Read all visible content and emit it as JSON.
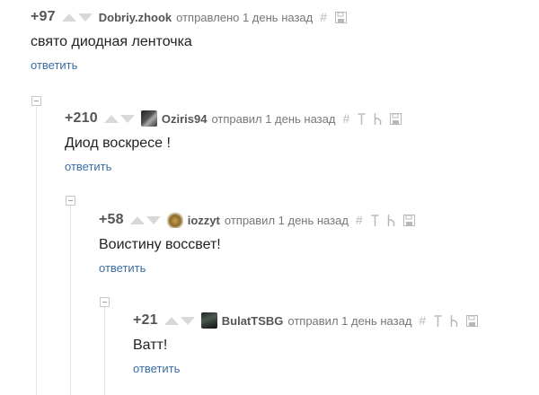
{
  "comments": [
    {
      "rating": "+97",
      "username": "Dobriy.zhook",
      "action": "отправлено 1 день назад",
      "text": "свято диодная ленточка",
      "reply": "ответить",
      "icons": [
        "hash-icon",
        "save-icon"
      ],
      "avatar_color": null
    },
    {
      "rating": "+210",
      "username": "Oziris94",
      "action": "отправил 1 день назад",
      "text": "Диод воскресе !",
      "reply": "ответить",
      "icons": [
        "hash-icon",
        "parent-arrow-icon",
        "branch-icon",
        "save-icon"
      ],
      "avatar_color": "#3a3a3a"
    },
    {
      "rating": "+58",
      "username": "iozzyt",
      "action": "отправил 1 день назад",
      "text": "Воистину воссвет!",
      "reply": "ответить",
      "icons": [
        "hash-icon",
        "parent-arrow-icon",
        "branch-icon",
        "save-icon"
      ],
      "avatar_color": "#9a7a3a"
    },
    {
      "rating": "+21",
      "username": "BulatTSBG",
      "action": "отправил 1 день назад",
      "text": "Ватт!",
      "reply": "ответить",
      "icons": [
        "hash-icon",
        "parent-arrow-icon",
        "branch-icon",
        "save-icon"
      ],
      "avatar_color": "#2d3a34"
    }
  ],
  "colors": {
    "link": "#3a6da5",
    "vote_arrow": "#d8d8d8",
    "icon": "#b8b8b8"
  }
}
